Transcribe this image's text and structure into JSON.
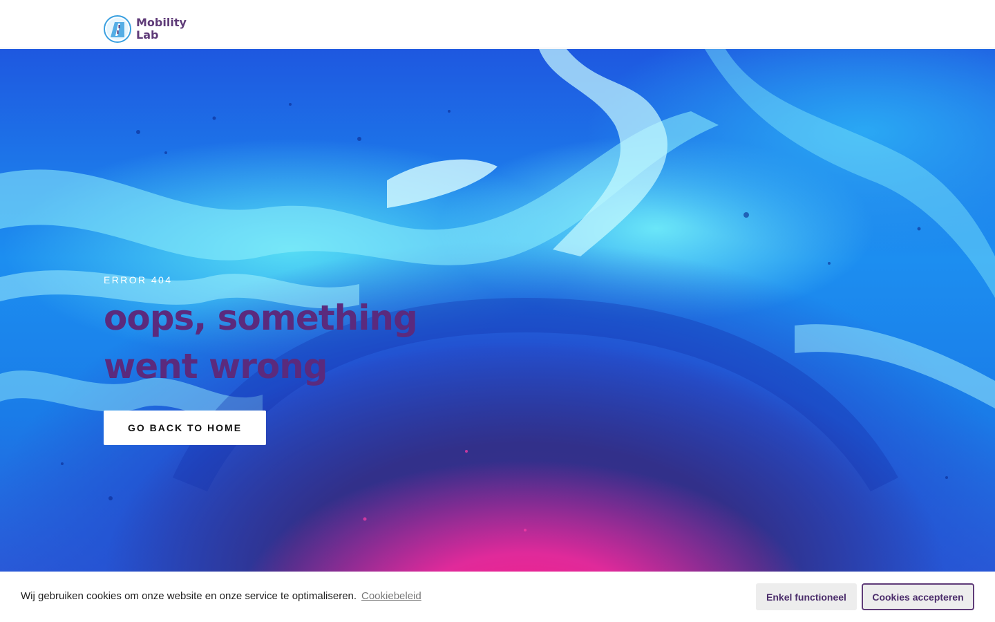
{
  "header": {
    "logo_line1": "Mobility",
    "logo_line2": "Lab",
    "logo_icon": "lab-flask-logo"
  },
  "hero": {
    "eyebrow": "ERROR 404",
    "headline_line1": "oops, something",
    "headline_line2": "went wrong",
    "button_label": "GO BACK TO HOME"
  },
  "cookie_bar": {
    "message": "Wij gebruiken cookies om onze website en onze service te optimaliseren.",
    "policy_link": "Cookiebeleid",
    "functional_button": "Enkel functioneel",
    "accept_button": "Cookies accepteren"
  },
  "colors": {
    "brand_purple": "#5f3b78",
    "headline_purple": "#5b2a7d",
    "button_bg": "#ffffff",
    "cookie_button_bg": "#ededed"
  }
}
